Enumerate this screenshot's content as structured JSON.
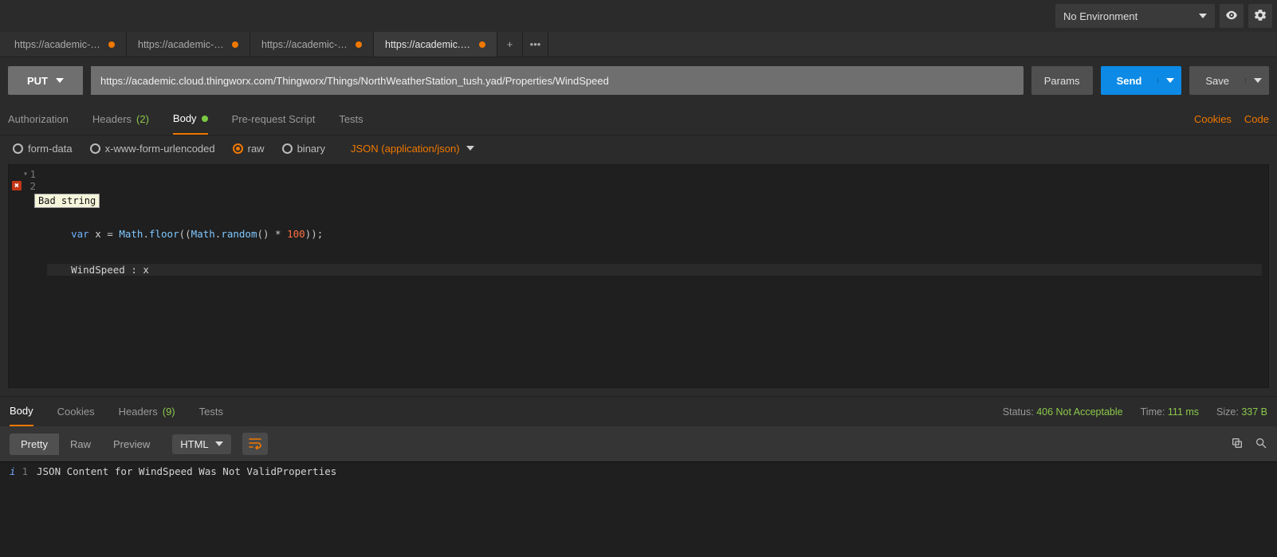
{
  "env": {
    "label": "No Environment"
  },
  "tabs": [
    {
      "label": "https://academic-edu",
      "dirty": true,
      "active": false
    },
    {
      "label": "https://academic-edu",
      "dirty": true,
      "active": false
    },
    {
      "label": "https://academic-edu",
      "dirty": true,
      "active": false
    },
    {
      "label": "https://academic.clou",
      "dirty": true,
      "active": true
    }
  ],
  "request": {
    "method": "PUT",
    "url": "https://academic.cloud.thingworx.com/Thingworx/Things/NorthWeatherStation_tush.yad/Properties/WindSpeed",
    "params_label": "Params",
    "send_label": "Send",
    "save_label": "Save"
  },
  "reqtabs": {
    "authorization": "Authorization",
    "headers": "Headers",
    "headers_count": "(2)",
    "body": "Body",
    "prereq": "Pre-request Script",
    "tests": "Tests",
    "cookies": "Cookies",
    "code": "Code"
  },
  "body_opts": {
    "formdata": "form-data",
    "urlencoded": "x-www-form-urlencoded",
    "raw": "raw",
    "binary": "binary",
    "content_type": "JSON (application/json)"
  },
  "editor": {
    "line1": "{",
    "line2_prefix": "    var x = Math.floor((Math.random() * ",
    "line2_num": "100",
    "line2_suffix": "));",
    "line3": "    WindSpeed : x",
    "error_tooltip": "Bad string"
  },
  "response": {
    "tabs": {
      "body": "Body",
      "cookies": "Cookies",
      "headers": "Headers",
      "headers_count": "(9)",
      "tests": "Tests"
    },
    "status_label": "Status:",
    "status_value": "406 Not Acceptable",
    "time_label": "Time:",
    "time_value": "111 ms",
    "size_label": "Size:",
    "size_value": "337 B",
    "views": {
      "pretty": "Pretty",
      "raw": "Raw",
      "preview": "Preview"
    },
    "format": "HTML",
    "text": "JSON Content for WindSpeed Was Not ValidProperties"
  }
}
